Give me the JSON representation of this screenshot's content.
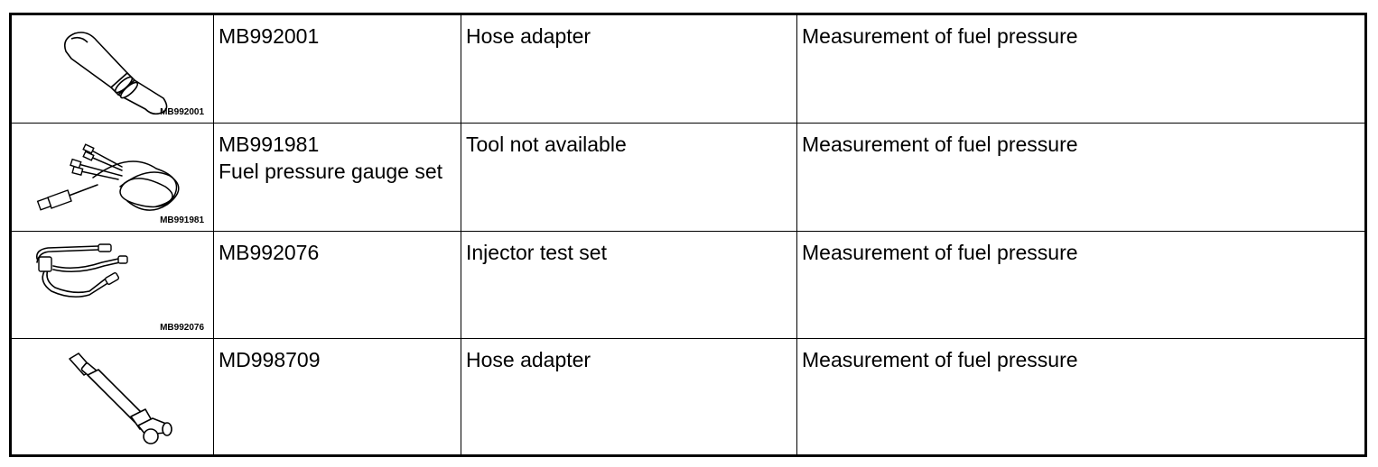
{
  "tools": [
    {
      "image_label": "MB992001",
      "part_number": "MB992001",
      "name": "Hose adapter",
      "application": "Measurement of fuel pressure",
      "icon": "hose-adapter-icon"
    },
    {
      "image_label": "MB991981",
      "part_number": "MB991981\nFuel pressure gauge set",
      "name": "Tool not available",
      "application": "Measurement of fuel pressure",
      "icon": "fuel-pressure-gauge-set-icon"
    },
    {
      "image_label": "MB992076",
      "part_number": "MB992076",
      "name": "Injector test set",
      "application": "Measurement of fuel pressure",
      "icon": "injector-test-set-icon"
    },
    {
      "image_label": "",
      "part_number": "MD998709",
      "name": "Hose adapter",
      "application": "Measurement of fuel pressure",
      "icon": "hose-adapter-bent-icon"
    }
  ]
}
